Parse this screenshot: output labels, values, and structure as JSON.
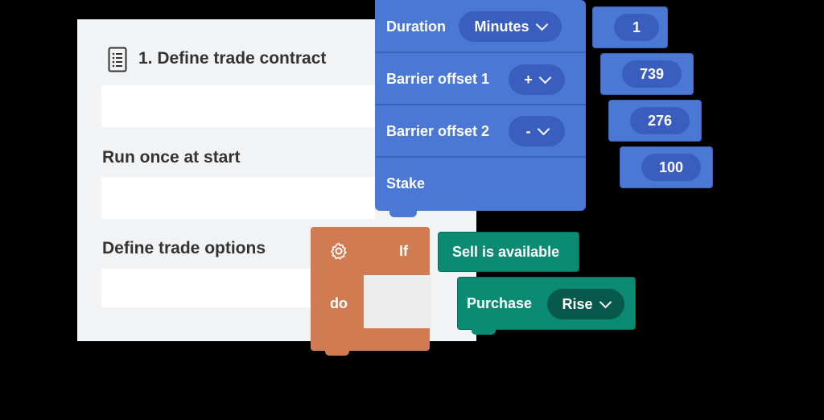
{
  "panel": {
    "title": "1. Define trade contract",
    "run_once": "Run once at start",
    "define_options": "Define trade options"
  },
  "blocks": {
    "duration": {
      "label": "Duration",
      "unit": "Minutes",
      "value": "1"
    },
    "barrier1": {
      "label": "Barrier offset 1",
      "sign": "+",
      "value": "739"
    },
    "barrier2": {
      "label": "Barrier offset 2",
      "sign": "-",
      "value": "276"
    },
    "stake": {
      "label": "Stake",
      "value": "100"
    },
    "if_block": {
      "if_label": "If",
      "do_label": "do",
      "condition": "Sell is available"
    },
    "purchase": {
      "label": "Purchase",
      "option": "Rise"
    }
  },
  "icons": {
    "document": "document-list-icon",
    "settings": "gear-icon",
    "dropdown": "chevron-down-icon"
  },
  "colors": {
    "blue_block": "#4a78d4",
    "blue_pill": "#3a5ec0",
    "orange_block": "#d07b52",
    "green_block": "#0b8a74",
    "green_pill": "#075a4b",
    "panel_bg": "#f2f3f4"
  }
}
